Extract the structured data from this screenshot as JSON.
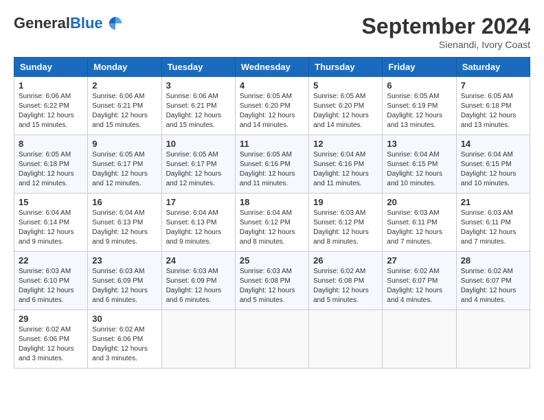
{
  "header": {
    "logo_general": "General",
    "logo_blue": "Blue",
    "month_title": "September 2024",
    "location": "Sienandi, Ivory Coast"
  },
  "days_of_week": [
    "Sunday",
    "Monday",
    "Tuesday",
    "Wednesday",
    "Thursday",
    "Friday",
    "Saturday"
  ],
  "weeks": [
    [
      {
        "day": "1",
        "sunrise": "6:06 AM",
        "sunset": "6:22 PM",
        "daylight": "12 hours and 15 minutes."
      },
      {
        "day": "2",
        "sunrise": "6:06 AM",
        "sunset": "6:21 PM",
        "daylight": "12 hours and 15 minutes."
      },
      {
        "day": "3",
        "sunrise": "6:06 AM",
        "sunset": "6:21 PM",
        "daylight": "12 hours and 15 minutes."
      },
      {
        "day": "4",
        "sunrise": "6:05 AM",
        "sunset": "6:20 PM",
        "daylight": "12 hours and 14 minutes."
      },
      {
        "day": "5",
        "sunrise": "6:05 AM",
        "sunset": "6:20 PM",
        "daylight": "12 hours and 14 minutes."
      },
      {
        "day": "6",
        "sunrise": "6:05 AM",
        "sunset": "6:19 PM",
        "daylight": "12 hours and 13 minutes."
      },
      {
        "day": "7",
        "sunrise": "6:05 AM",
        "sunset": "6:18 PM",
        "daylight": "12 hours and 13 minutes."
      }
    ],
    [
      {
        "day": "8",
        "sunrise": "6:05 AM",
        "sunset": "6:18 PM",
        "daylight": "12 hours and 12 minutes."
      },
      {
        "day": "9",
        "sunrise": "6:05 AM",
        "sunset": "6:17 PM",
        "daylight": "12 hours and 12 minutes."
      },
      {
        "day": "10",
        "sunrise": "6:05 AM",
        "sunset": "6:17 PM",
        "daylight": "12 hours and 12 minutes."
      },
      {
        "day": "11",
        "sunrise": "6:05 AM",
        "sunset": "6:16 PM",
        "daylight": "12 hours and 11 minutes."
      },
      {
        "day": "12",
        "sunrise": "6:04 AM",
        "sunset": "6:16 PM",
        "daylight": "12 hours and 11 minutes."
      },
      {
        "day": "13",
        "sunrise": "6:04 AM",
        "sunset": "6:15 PM",
        "daylight": "12 hours and 10 minutes."
      },
      {
        "day": "14",
        "sunrise": "6:04 AM",
        "sunset": "6:15 PM",
        "daylight": "12 hours and 10 minutes."
      }
    ],
    [
      {
        "day": "15",
        "sunrise": "6:04 AM",
        "sunset": "6:14 PM",
        "daylight": "12 hours and 9 minutes."
      },
      {
        "day": "16",
        "sunrise": "6:04 AM",
        "sunset": "6:13 PM",
        "daylight": "12 hours and 9 minutes."
      },
      {
        "day": "17",
        "sunrise": "6:04 AM",
        "sunset": "6:13 PM",
        "daylight": "12 hours and 9 minutes."
      },
      {
        "day": "18",
        "sunrise": "6:04 AM",
        "sunset": "6:12 PM",
        "daylight": "12 hours and 8 minutes."
      },
      {
        "day": "19",
        "sunrise": "6:03 AM",
        "sunset": "6:12 PM",
        "daylight": "12 hours and 8 minutes."
      },
      {
        "day": "20",
        "sunrise": "6:03 AM",
        "sunset": "6:11 PM",
        "daylight": "12 hours and 7 minutes."
      },
      {
        "day": "21",
        "sunrise": "6:03 AM",
        "sunset": "6:11 PM",
        "daylight": "12 hours and 7 minutes."
      }
    ],
    [
      {
        "day": "22",
        "sunrise": "6:03 AM",
        "sunset": "6:10 PM",
        "daylight": "12 hours and 6 minutes."
      },
      {
        "day": "23",
        "sunrise": "6:03 AM",
        "sunset": "6:09 PM",
        "daylight": "12 hours and 6 minutes."
      },
      {
        "day": "24",
        "sunrise": "6:03 AM",
        "sunset": "6:09 PM",
        "daylight": "12 hours and 6 minutes."
      },
      {
        "day": "25",
        "sunrise": "6:03 AM",
        "sunset": "6:08 PM",
        "daylight": "12 hours and 5 minutes."
      },
      {
        "day": "26",
        "sunrise": "6:02 AM",
        "sunset": "6:08 PM",
        "daylight": "12 hours and 5 minutes."
      },
      {
        "day": "27",
        "sunrise": "6:02 AM",
        "sunset": "6:07 PM",
        "daylight": "12 hours and 4 minutes."
      },
      {
        "day": "28",
        "sunrise": "6:02 AM",
        "sunset": "6:07 PM",
        "daylight": "12 hours and 4 minutes."
      }
    ],
    [
      {
        "day": "29",
        "sunrise": "6:02 AM",
        "sunset": "6:06 PM",
        "daylight": "12 hours and 3 minutes."
      },
      {
        "day": "30",
        "sunrise": "6:02 AM",
        "sunset": "6:06 PM",
        "daylight": "12 hours and 3 minutes."
      },
      null,
      null,
      null,
      null,
      null
    ]
  ]
}
